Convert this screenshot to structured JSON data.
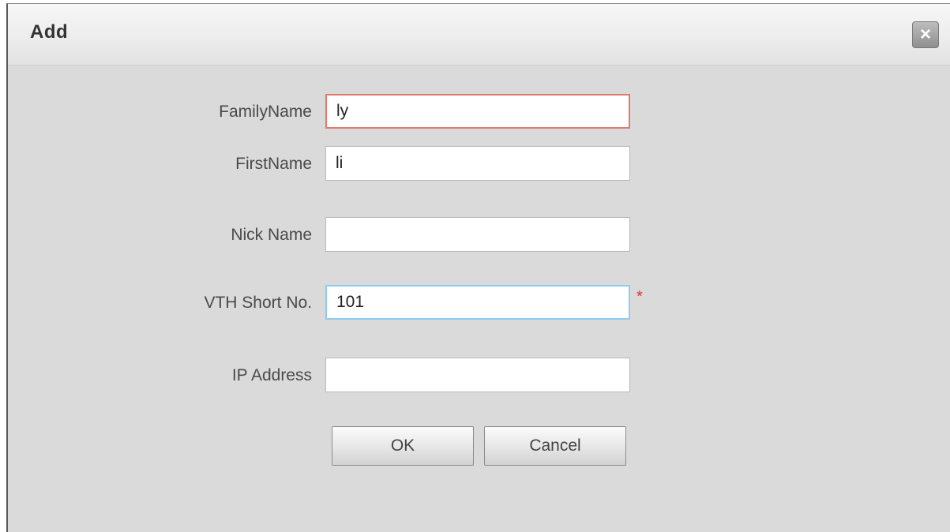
{
  "dialog": {
    "title": "Add",
    "close_symbol": "×",
    "close_icon": "close-icon"
  },
  "form": {
    "family_name": {
      "label": "FamilyName",
      "value": "ly"
    },
    "first_name": {
      "label": "FirstName",
      "value": "li"
    },
    "nick_name": {
      "label": "Nick Name",
      "value": ""
    },
    "vth_short_no": {
      "label": "VTH Short No.",
      "value": "101",
      "required_mark": "*"
    },
    "ip_address": {
      "label": "IP Address",
      "value": ""
    }
  },
  "buttons": {
    "ok_label": "OK",
    "cancel_label": "Cancel"
  },
  "colors": {
    "error_border": "#e07a6e",
    "focus_border": "#8ecbf0",
    "required": "#e0302e"
  }
}
